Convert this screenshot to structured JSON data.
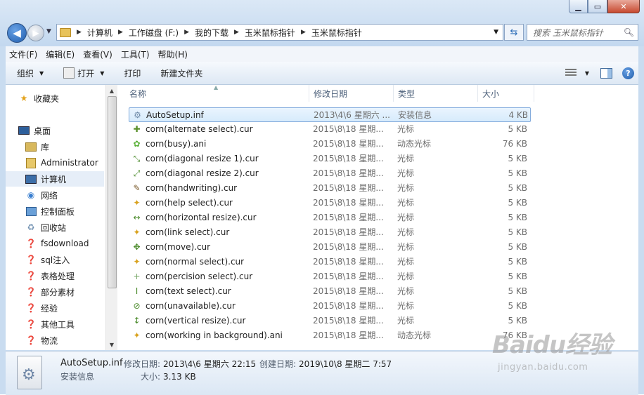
{
  "window": {
    "minimize_icon": "minimize-icon",
    "maximize_icon": "maximize-icon",
    "close_icon": "close-icon"
  },
  "address": {
    "crumbs": [
      "计算机",
      "工作磁盘 (F:)",
      "我的下载",
      "玉米鼠标指针",
      "玉米鼠标指针"
    ]
  },
  "search": {
    "placeholder": "搜索 玉米鼠标指针"
  },
  "menu": {
    "items": [
      "文件(F)",
      "编辑(E)",
      "查看(V)",
      "工具(T)",
      "帮助(H)"
    ]
  },
  "toolbar": {
    "organize": "组织",
    "open": "打开",
    "print": "打印",
    "new_folder": "新建文件夹"
  },
  "nav": {
    "items": [
      {
        "label": "收藏夹",
        "icon": "star-icon"
      },
      {
        "label": "桌面",
        "icon": "desktop-icon"
      },
      {
        "label": "库",
        "icon": "library-icon"
      },
      {
        "label": "Administrator",
        "icon": "user-folder-icon"
      },
      {
        "label": "计算机",
        "icon": "computer-icon",
        "selected": true
      },
      {
        "label": "网络",
        "icon": "network-icon"
      },
      {
        "label": "控制面板",
        "icon": "control-panel-icon"
      },
      {
        "label": "回收站",
        "icon": "recycle-bin-icon"
      },
      {
        "label": "fsdownload",
        "icon": "unknown-folder-icon"
      },
      {
        "label": "sql注入",
        "icon": "unknown-folder-icon"
      },
      {
        "label": "表格处理",
        "icon": "unknown-folder-icon"
      },
      {
        "label": "部分素材",
        "icon": "unknown-folder-icon"
      },
      {
        "label": "经验",
        "icon": "unknown-folder-icon"
      },
      {
        "label": "其他工具",
        "icon": "unknown-folder-icon"
      },
      {
        "label": "物流",
        "icon": "unknown-folder-icon"
      }
    ]
  },
  "columns": {
    "name": "名称",
    "date": "修改日期",
    "type": "类型",
    "size": "大小"
  },
  "files": [
    {
      "name": "AutoSetup.inf",
      "date": "2013\\4\\6 星期六 ...",
      "type": "安装信息",
      "size": "4 KB",
      "icon": "setup-info-icon",
      "selected": true
    },
    {
      "name": "corn(alternate select).cur",
      "date": "2015\\8\\18 星期...",
      "type": "光标",
      "size": "5 KB",
      "icon": "cursor-arrow-icon"
    },
    {
      "name": "corn(busy).ani",
      "date": "2015\\8\\18 星期...",
      "type": "动态光标",
      "size": "76 KB",
      "icon": "busy-cursor-icon"
    },
    {
      "name": "corn(diagonal resize 1).cur",
      "date": "2015\\8\\18 星期...",
      "type": "光标",
      "size": "5 KB",
      "icon": "diagonal-resize-icon"
    },
    {
      "name": "corn(diagonal resize 2).cur",
      "date": "2015\\8\\18 星期...",
      "type": "光标",
      "size": "5 KB",
      "icon": "diagonal-resize-icon"
    },
    {
      "name": "corn(handwriting).cur",
      "date": "2015\\8\\18 星期...",
      "type": "光标",
      "size": "5 KB",
      "icon": "pen-cursor-icon"
    },
    {
      "name": "corn(help select).cur",
      "date": "2015\\8\\18 星期...",
      "type": "光标",
      "size": "5 KB",
      "icon": "corn-cursor-icon"
    },
    {
      "name": "corn(horizontal resize).cur",
      "date": "2015\\8\\18 星期...",
      "type": "光标",
      "size": "5 KB",
      "icon": "horizontal-resize-icon"
    },
    {
      "name": "corn(link select).cur",
      "date": "2015\\8\\18 星期...",
      "type": "光标",
      "size": "5 KB",
      "icon": "corn-cursor-icon"
    },
    {
      "name": "corn(move).cur",
      "date": "2015\\8\\18 星期...",
      "type": "光标",
      "size": "5 KB",
      "icon": "move-cursor-icon"
    },
    {
      "name": "corn(normal select).cur",
      "date": "2015\\8\\18 星期...",
      "type": "光标",
      "size": "5 KB",
      "icon": "corn-cursor-icon"
    },
    {
      "name": "corn(percision select).cur",
      "date": "2015\\8\\18 星期...",
      "type": "光标",
      "size": "5 KB",
      "icon": "crosshair-icon"
    },
    {
      "name": "corn(text select).cur",
      "date": "2015\\8\\18 星期...",
      "type": "光标",
      "size": "5 KB",
      "icon": "text-cursor-icon"
    },
    {
      "name": "corn(unavailable).cur",
      "date": "2015\\8\\18 星期...",
      "type": "光标",
      "size": "5 KB",
      "icon": "unavailable-icon"
    },
    {
      "name": "corn(vertical resize).cur",
      "date": "2015\\8\\18 星期...",
      "type": "光标",
      "size": "5 KB",
      "icon": "vertical-resize-icon"
    },
    {
      "name": "corn(working in background).ani",
      "date": "2015\\8\\18 星期...",
      "type": "动态光标",
      "size": "76 KB",
      "icon": "corn-cursor-icon"
    }
  ],
  "details": {
    "name": "AutoSetup.inf",
    "type": "安装信息",
    "modified_label": "修改日期:",
    "modified_value": "2013\\4\\6 星期六 22:15",
    "created_label": "创建日期:",
    "created_value": "2019\\10\\8 星期二 7:57",
    "size_label": "大小:",
    "size_value": "3.13 KB"
  },
  "watermark": {
    "logo": "Baidu经验",
    "sub": "jingyan.baidu.com"
  }
}
